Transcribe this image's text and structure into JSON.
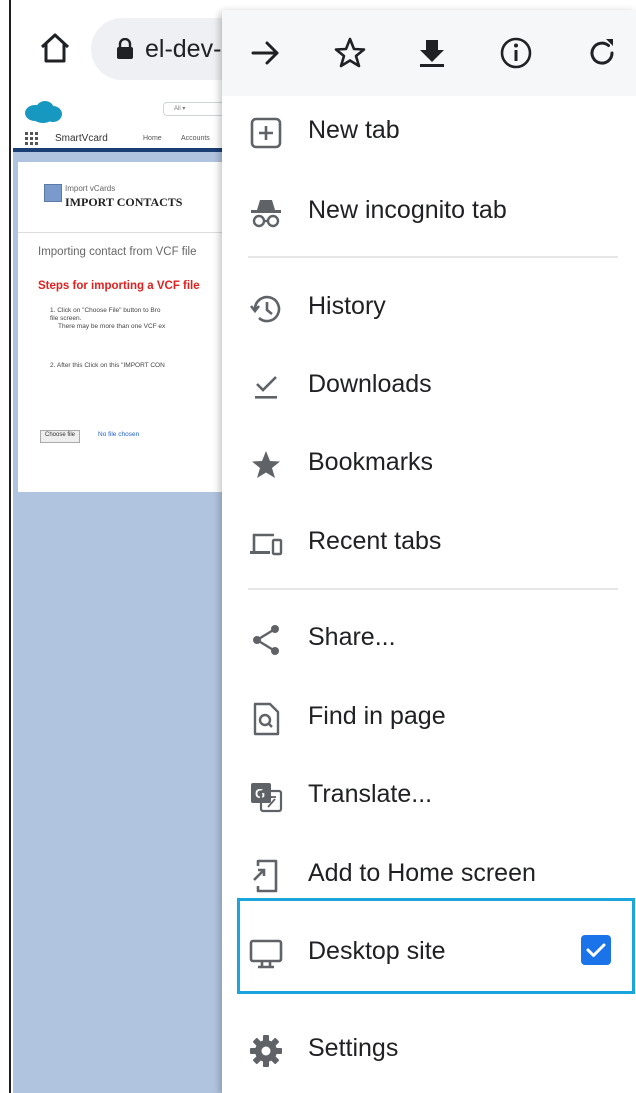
{
  "browser": {
    "url_fragment": "el-dev-"
  },
  "webpage": {
    "search_placeholder": "All ▾",
    "app_name": "SmartVcard",
    "nav_items": [
      "Home",
      "Accounts"
    ],
    "card": {
      "subtitle": "Import vCards",
      "title": "IMPORT CONTACTS",
      "intro": "Importing contact from VCF file",
      "steps_heading": "Steps for importing a VCF file",
      "step1_a": "1. Click on \"Choose File\" button to Bro",
      "step1_b": "file screen.",
      "step1_c": "There may be more than one VCF ex",
      "step2": "2. After this Click on this \"IMPORT CON",
      "choose_file_label": "Choose file",
      "no_file_label": "No file chosen"
    }
  },
  "menu": {
    "items": [
      {
        "label": "New tab",
        "icon": "new-tab-icon"
      },
      {
        "label": "New incognito tab",
        "icon": "incognito-icon"
      },
      {
        "label": "History",
        "icon": "history-icon"
      },
      {
        "label": "Downloads",
        "icon": "downloads-icon"
      },
      {
        "label": "Bookmarks",
        "icon": "bookmarks-star-icon"
      },
      {
        "label": "Recent tabs",
        "icon": "recent-tabs-icon"
      },
      {
        "label": "Share...",
        "icon": "share-icon"
      },
      {
        "label": "Find in page",
        "icon": "find-in-page-icon"
      },
      {
        "label": "Translate...",
        "icon": "translate-icon"
      },
      {
        "label": "Add to Home screen",
        "icon": "add-to-home-icon"
      },
      {
        "label": "Desktop site",
        "icon": "desktop-icon",
        "checked": true
      },
      {
        "label": "Settings",
        "icon": "settings-gear-icon"
      }
    ]
  },
  "colors": {
    "accent": "#1a73e8",
    "highlight_border": "#1aa6dc",
    "page_background": "#b1c4df",
    "steps_heading": "#e02020"
  }
}
